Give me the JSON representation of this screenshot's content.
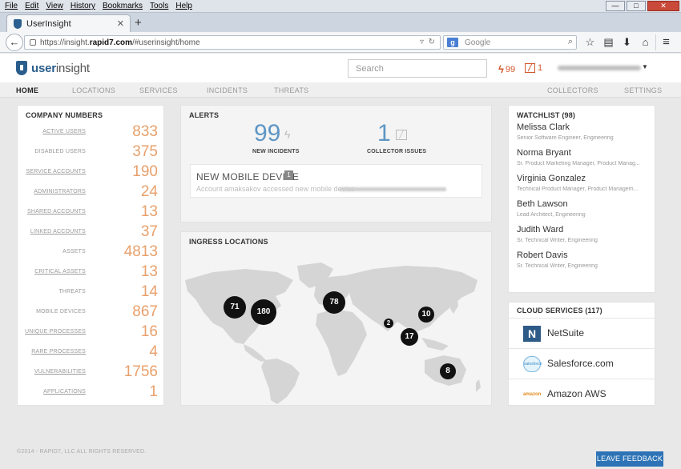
{
  "browser": {
    "menu": [
      "File",
      "Edit",
      "View",
      "History",
      "Bookmarks",
      "Tools",
      "Help"
    ],
    "window_buttons": {
      "minimize": "—",
      "restore": "□",
      "close": "✕"
    },
    "tab_title": "UserInsight",
    "url_prefix": "https://insight.",
    "url_host": "rapid7.com",
    "url_rest": "/#userinsight/home",
    "search_engine": "Google",
    "search_engine_mark": "g",
    "icons": [
      "star-icon",
      "reading-list-icon",
      "download-icon",
      "home-icon",
      "menu-icon"
    ]
  },
  "app": {
    "logo_part1": "user",
    "logo_part2": "insight",
    "search_placeholder": "Search",
    "incident_count": "99",
    "collector_count": "1",
    "nav": {
      "home": "HOME",
      "locations": "LOCATIONS",
      "services": "SERVICES",
      "incidents": "INCIDENTS",
      "threats": "THREATS",
      "collectors": "COLLECTORS",
      "settings": "SETTINGS"
    }
  },
  "company_numbers": {
    "title": "COMPANY NUMBERS",
    "items": [
      {
        "label": "ACTIVE USERS",
        "value": "833",
        "link": true
      },
      {
        "label": "DISABLED USERS",
        "value": "375",
        "link": false
      },
      {
        "label": "SERVICE ACCOUNTS",
        "value": "190",
        "link": true
      },
      {
        "label": "ADMINISTRATORS",
        "value": "24",
        "link": true
      },
      {
        "label": "SHARED ACCOUNTS",
        "value": "13",
        "link": true
      },
      {
        "label": "LINKED ACCOUNTS",
        "value": "37",
        "link": true
      },
      {
        "label": "ASSETS",
        "value": "4813",
        "link": false
      },
      {
        "label": "CRITICAL ASSETS",
        "value": "13",
        "link": true
      },
      {
        "label": "THREATS",
        "value": "14",
        "link": false
      },
      {
        "label": "MOBILE DEVICES",
        "value": "867",
        "link": false
      },
      {
        "label": "UNIQUE PROCESSES",
        "value": "16",
        "link": true
      },
      {
        "label": "RARE PROCESSES",
        "value": "4",
        "link": true
      },
      {
        "label": "VULNERABILITIES",
        "value": "1756",
        "link": true
      },
      {
        "label": "APPLICATIONS",
        "value": "1",
        "link": true
      }
    ]
  },
  "alerts": {
    "title": "ALERTS",
    "new_incidents_value": "99",
    "new_incidents_label": "NEW INCIDENTS",
    "collector_issues_value": "1",
    "collector_issues_label": "COLLECTOR ISSUES",
    "card_title": "NEW MOBILE DEVICE",
    "card_badge": "1",
    "card_text": "Account amaksakov accessed new mobile device"
  },
  "ingress": {
    "title": "INGRESS LOCATIONS",
    "clusters": [
      "71",
      "180",
      "78",
      "2",
      "10",
      "17",
      "8"
    ]
  },
  "watchlist": {
    "title": "WATCHLIST (98)",
    "people": [
      {
        "name": "Melissa Clark",
        "role": "Senior Software Engineer, Engineering"
      },
      {
        "name": "Norma Bryant",
        "role": "Sr. Product Marketing Manager, Product Manag..."
      },
      {
        "name": "Virginia Gonzalez",
        "role": "Technical Product Manager, Product Managem..."
      },
      {
        "name": "Beth Lawson",
        "role": "Lead Architect, Engineering"
      },
      {
        "name": "Judith Ward",
        "role": "Sr. Technical Writer, Engineering"
      },
      {
        "name": "Robert Davis",
        "role": "Sr. Technical Writer, Engineering"
      }
    ]
  },
  "cloud_services": {
    "title": "CLOUD SERVICES (117)",
    "items": [
      {
        "name": "NetSuite",
        "mark": "N"
      },
      {
        "name": "Salesforce.com",
        "mark": "salesforce"
      },
      {
        "name": "Amazon AWS",
        "mark": "amazon"
      }
    ]
  },
  "footer": {
    "copyright": "©2014 - RAPID7, LLC ALL RIGHTS RESERVED.",
    "feedback": "LEAVE FEEDBACK"
  }
}
